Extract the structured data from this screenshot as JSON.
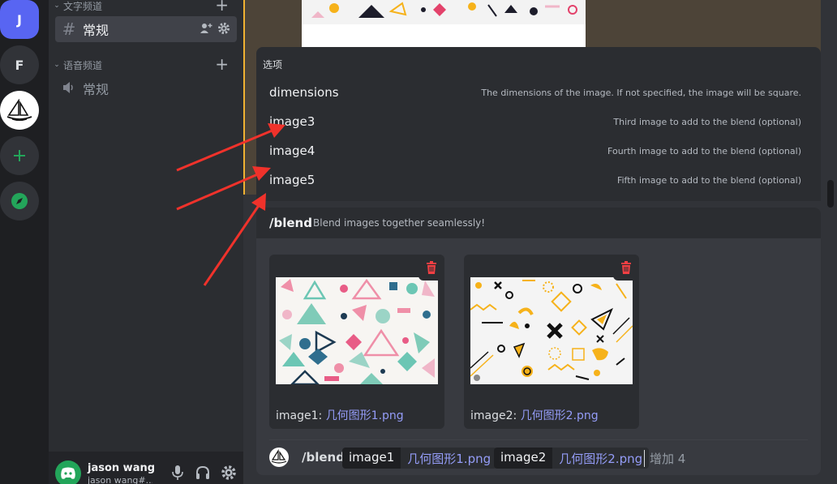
{
  "servers": [
    {
      "label": "J",
      "name": "server-j"
    },
    {
      "label": "F",
      "name": "server-f"
    },
    {
      "label": "",
      "name": "server-midjourney"
    },
    {
      "label": "+",
      "name": "add-server"
    },
    {
      "label": "",
      "name": "explore-servers"
    }
  ],
  "sidebar": {
    "text_category": "文字频道",
    "text_channel": "常规",
    "voice_category": "语音频道",
    "voice_channel": "常规"
  },
  "user": {
    "name": "jason wang",
    "tag": "jason wang#..."
  },
  "options_popup": {
    "title": "选项",
    "options": [
      {
        "name": "dimensions",
        "desc": "The dimensions of the image. If not specified, the image will be square."
      },
      {
        "name": "image3",
        "desc": "Third image to add to the blend (optional)"
      },
      {
        "name": "image4",
        "desc": "Fourth image to add to the blend (optional)"
      },
      {
        "name": "image5",
        "desc": "Fifth image to add to the blend (optional)"
      }
    ]
  },
  "command": {
    "name": "/blend",
    "desc": "Blend images together seamlessly!"
  },
  "attachments": [
    {
      "label": "image1: ",
      "file": "几何图形1.png"
    },
    {
      "label": "image2: ",
      "file": "几何图形2.png"
    }
  ],
  "input": {
    "slash": "/blend",
    "params": [
      {
        "key": "image1",
        "value": "几何图形1.png"
      },
      {
        "key": "image2",
        "value": "几何图形2.png"
      }
    ],
    "more": "增加 4"
  },
  "colors": {
    "accent": "#5865f2",
    "link": "#949cf7",
    "green": "#23a55a",
    "danger": "#f23f43",
    "arrow": "#f0322b"
  }
}
